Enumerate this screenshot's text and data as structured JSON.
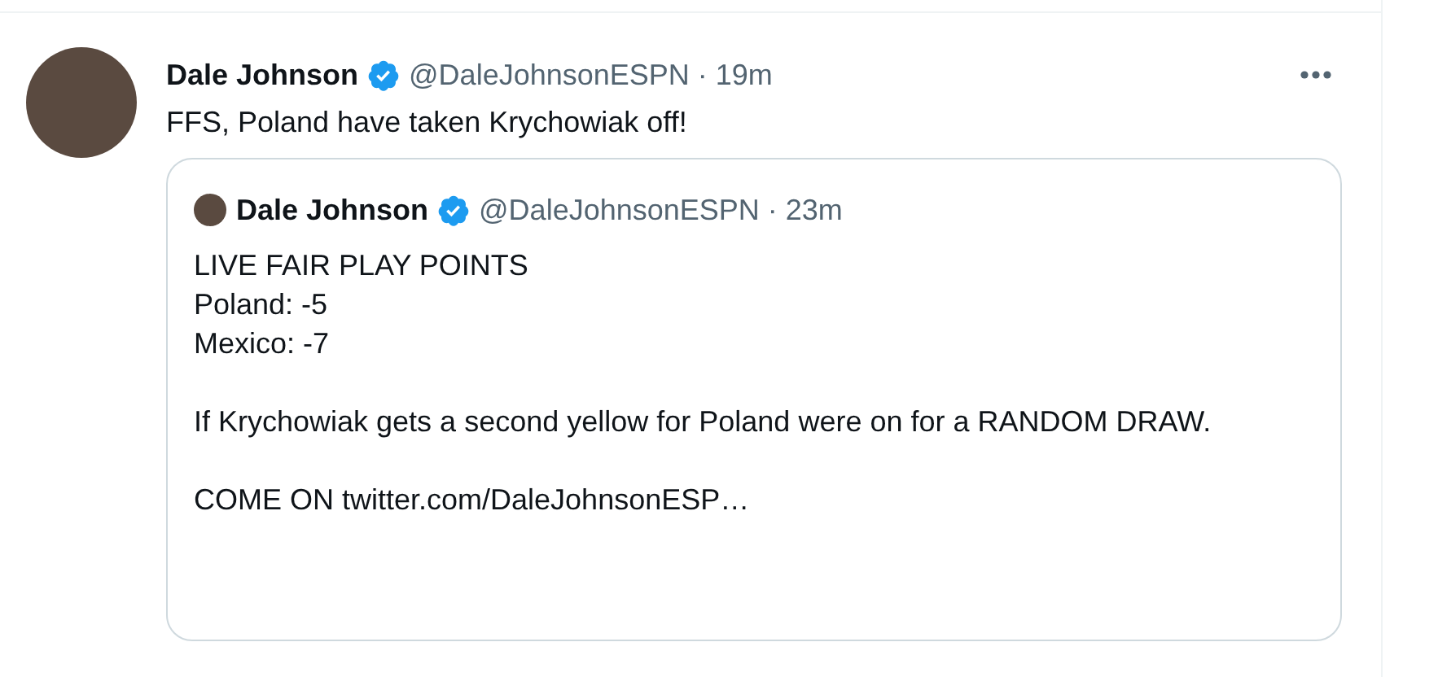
{
  "tweet": {
    "name": "Dale Johnson",
    "verified": true,
    "handle": "@DaleJohnsonESPN",
    "separator": "·",
    "time": "19m",
    "text": "FFS, Poland have taken Krychowiak off!",
    "quoted": {
      "name": "Dale Johnson",
      "verified": true,
      "handle": "@DaleJohnsonESPN",
      "separator": "·",
      "time": "23m",
      "paragraphs": [
        "LIVE FAIR PLAY POINTS\nPoland: -5\nMexico: -7",
        "If Krychowiak gets a second yellow for Poland were on for a RANDOM DRAW.",
        "COME ON twitter.com/DaleJohnsonESP…"
      ]
    }
  }
}
